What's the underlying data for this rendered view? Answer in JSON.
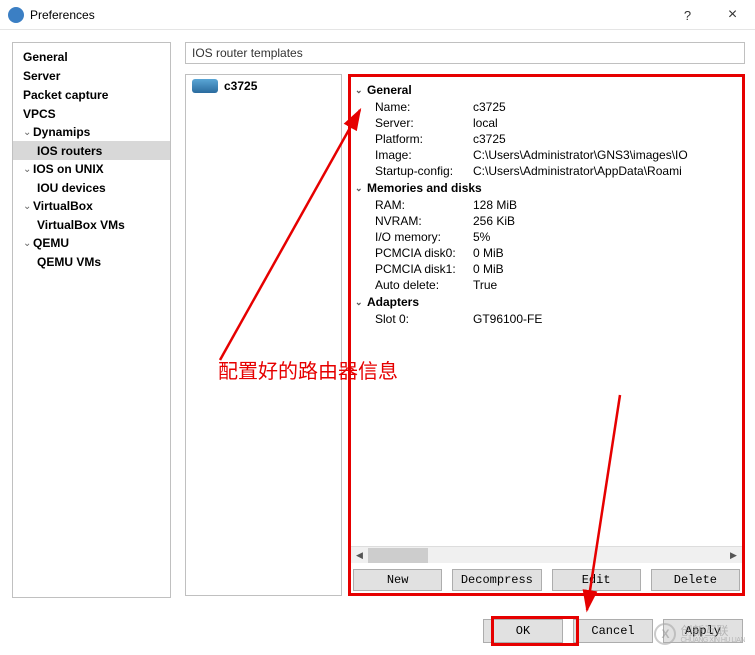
{
  "window": {
    "title": "Preferences",
    "help": "?",
    "close": "×"
  },
  "sidebar": {
    "items": [
      {
        "label": "General",
        "type": "top"
      },
      {
        "label": "Server",
        "type": "top"
      },
      {
        "label": "Packet capture",
        "type": "top"
      },
      {
        "label": "VPCS",
        "type": "top"
      },
      {
        "label": "Dynamips",
        "type": "group"
      },
      {
        "label": "IOS routers",
        "type": "child",
        "selected": true
      },
      {
        "label": "IOS on UNIX",
        "type": "group"
      },
      {
        "label": "IOU devices",
        "type": "child"
      },
      {
        "label": "VirtualBox",
        "type": "group"
      },
      {
        "label": "VirtualBox VMs",
        "type": "child"
      },
      {
        "label": "QEMU",
        "type": "group"
      },
      {
        "label": "QEMU VMs",
        "type": "child"
      }
    ]
  },
  "main_header": "IOS router templates",
  "router_list": {
    "items": [
      {
        "label": "c3725"
      }
    ]
  },
  "detail": {
    "groups": [
      {
        "title": "General",
        "props": [
          {
            "label": "Name:",
            "value": "c3725"
          },
          {
            "label": "Server:",
            "value": "local"
          },
          {
            "label": "Platform:",
            "value": "c3725"
          },
          {
            "label": "Image:",
            "value": "C:\\Users\\Administrator\\GNS3\\images\\IO"
          },
          {
            "label": "Startup-config:",
            "value": "C:\\Users\\Administrator\\AppData\\Roami"
          }
        ]
      },
      {
        "title": "Memories and disks",
        "props": [
          {
            "label": "RAM:",
            "value": "128 MiB"
          },
          {
            "label": "NVRAM:",
            "value": "256 KiB"
          },
          {
            "label": "I/O memory:",
            "value": "5%"
          },
          {
            "label": "PCMCIA disk0:",
            "value": "0 MiB"
          },
          {
            "label": "PCMCIA disk1:",
            "value": "0 MiB"
          },
          {
            "label": "Auto delete:",
            "value": "True"
          }
        ]
      },
      {
        "title": "Adapters",
        "props": [
          {
            "label": "Slot 0:",
            "value": "GT96100-FE"
          }
        ]
      }
    ]
  },
  "buttons": {
    "new": "New",
    "decompress": "Decompress",
    "edit": "Edit",
    "delete": "Delete",
    "ok": "OK",
    "cancel": "Cancel",
    "apply": "Apply"
  },
  "annotation": {
    "text": "配置好的路由器信息"
  },
  "watermark": {
    "brand": "创新互联",
    "sub": "CHUANG XIN HU LIAN"
  }
}
